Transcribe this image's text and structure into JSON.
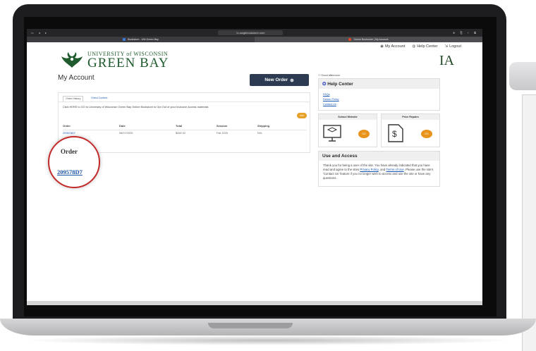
{
  "browser": {
    "address": "iu.uwgbbookstore.com",
    "tabs": [
      {
        "label": "Bookstore - UW-Green Bay",
        "active": false
      },
      {
        "label": "Online Bookstore | My Account",
        "active": true
      }
    ]
  },
  "toplinks": {
    "account": "My Account",
    "help": "Help Center",
    "logout": "Logout"
  },
  "brand": {
    "line1": "UNIVERSITY of WISCONSIN",
    "line2": "GREEN BAY",
    "ia": "IA",
    "green": "#1f5b2d"
  },
  "main": {
    "title": "My Account",
    "new_order": "New Order",
    "tabs": [
      "Order History",
      "Direct Content"
    ],
    "optout": "Click HERE to GO to University of Wisconsin Green Bay Online Bookstore to Opt Out of your Inclusive Access materials",
    "info_badge": "Info",
    "table": {
      "headers": [
        "Order",
        "Date",
        "Total",
        "Session",
        "Shipping"
      ],
      "rows": [
        [
          "209578D7",
          "08/07/2025",
          "$280.02",
          "Fall 2025",
          "N/A"
        ]
      ]
    }
  },
  "highlight": {
    "header": "Order",
    "order_number": "209578D7"
  },
  "side": {
    "greeting": "Good afternoon",
    "help_center": {
      "title": "Help Center",
      "links": [
        "FAQs",
        "Return Policy",
        "Contact Us"
      ]
    },
    "school_website": "School Website",
    "price_repairs": "Price Repairs",
    "go": "GO",
    "use_access": {
      "title": "Use and Access",
      "text_before": "Thank you for being a user of the site. You have already indicated that you have read and agree to the sites ",
      "privacy": "Privacy Policy",
      "and": ", and ",
      "terms": "Terms of Use",
      "text_after": ". Please use the site's 'Contact Us' feature if you no longer wish to access and use the site or have any questions."
    }
  }
}
